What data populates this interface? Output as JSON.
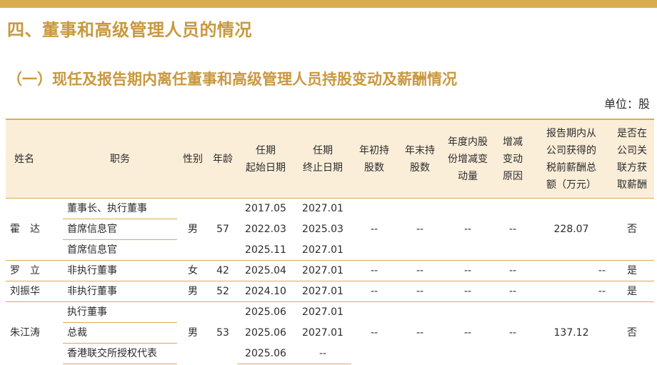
{
  "section_title": "四、董事和高级管理人员的情况",
  "subsection_title": "（一）现任及报告期内离任董事和高级管理人员持股变动及薪酬情况",
  "unit_label": "单位：股",
  "headers": {
    "name": "姓名",
    "role": "职务",
    "gender": "性别",
    "age": "年龄",
    "start": [
      "任期",
      "起始日期"
    ],
    "end": [
      "任期",
      "终止日期"
    ],
    "shares_begin": [
      "年初持",
      "股数"
    ],
    "shares_end": [
      "年末持",
      "股数"
    ],
    "shares_change": [
      "年度内股",
      "份增减变",
      "动量"
    ],
    "change_reason": [
      "增减",
      "变动",
      "原因"
    ],
    "pay": [
      "报告期内从",
      "公司获得的",
      "税前薪酬总",
      "额（万元）"
    ],
    "related_pay": [
      "是否在",
      "公司关",
      "联方获",
      "取薪酬"
    ]
  },
  "people": [
    {
      "name": "霍　达",
      "gender": "男",
      "age": "57",
      "shares_begin": "--",
      "shares_end": "--",
      "shares_change": "--",
      "change_reason": "--",
      "pay": "228.07",
      "related_pay": "否",
      "roles": [
        {
          "role": "董事长、执行董事",
          "start": "2017.05",
          "end": "2027.01"
        },
        {
          "role": "首席信息官",
          "start": "2022.03",
          "end": "2025.03"
        },
        {
          "role": "首席信息官",
          "start": "2025.11",
          "end": "2027.01"
        }
      ]
    },
    {
      "name": "罗　立",
      "gender": "女",
      "age": "42",
      "shares_begin": "--",
      "shares_end": "--",
      "shares_change": "--",
      "change_reason": "--",
      "pay": "--",
      "related_pay": "是",
      "roles": [
        {
          "role": "非执行董事",
          "start": "2025.04",
          "end": "2027.01"
        }
      ]
    },
    {
      "name": "刘振华",
      "gender": "男",
      "age": "52",
      "shares_begin": "--",
      "shares_end": "--",
      "shares_change": "--",
      "change_reason": "--",
      "pay": "--",
      "related_pay": "是",
      "roles": [
        {
          "role": "非执行董事",
          "start": "2024.10",
          "end": "2027.01"
        }
      ]
    },
    {
      "name": "朱江涛",
      "gender": "男",
      "age": "53",
      "shares_begin": "--",
      "shares_end": "--",
      "shares_change": "--",
      "change_reason": "--",
      "pay": "137.12",
      "related_pay": "否",
      "roles": [
        {
          "role": "执行董事",
          "start": "2025.06",
          "end": "2027.01"
        },
        {
          "role": "总裁",
          "start": "2025.06",
          "end": "2027.01"
        },
        {
          "role": "香港联交所授权代表",
          "start": "2025.06",
          "end": "--"
        }
      ]
    }
  ]
}
